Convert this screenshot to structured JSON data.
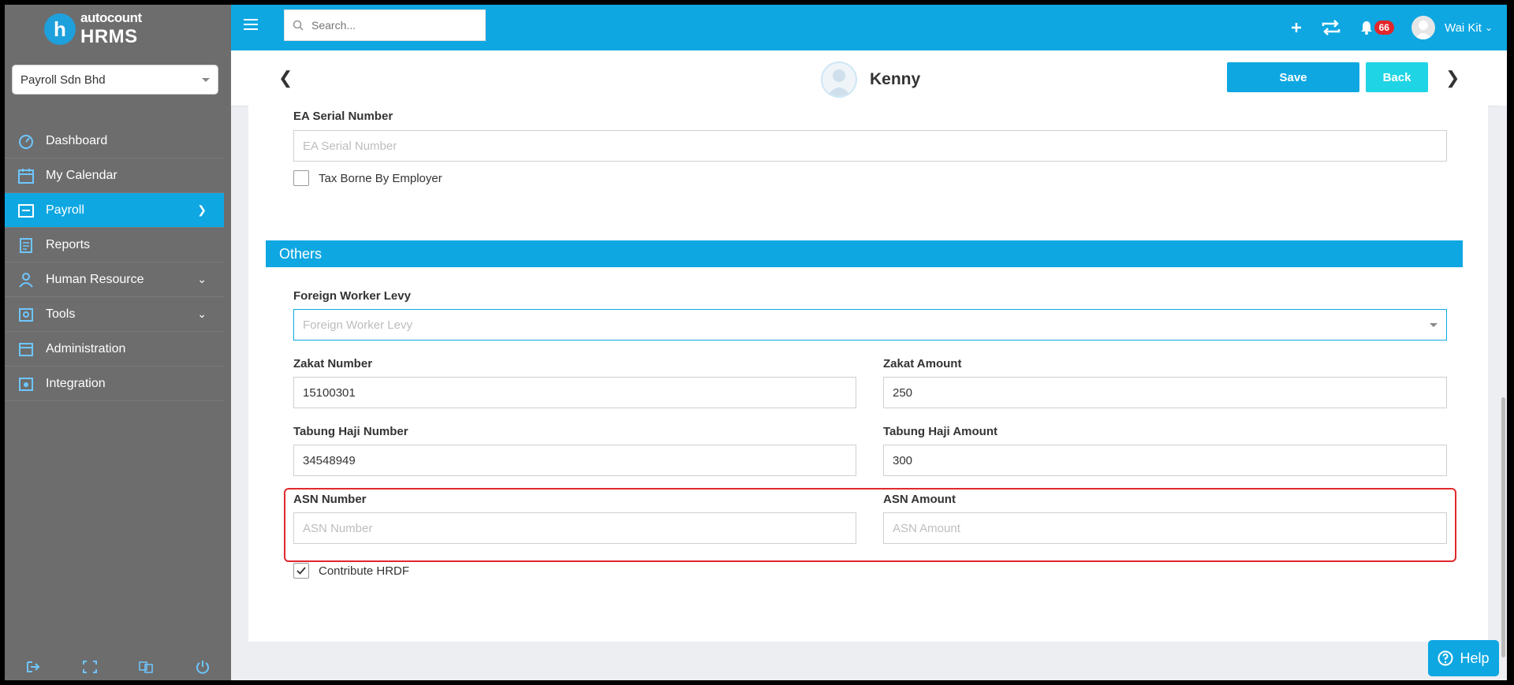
{
  "brand": {
    "mark": "h",
    "line1": "autocount",
    "line2": "HRMS"
  },
  "company_selector": {
    "value": "Payroll Sdn Bhd"
  },
  "sidebar": {
    "items": [
      {
        "label": "Dashboard",
        "icon": "dashboard-icon"
      },
      {
        "label": "My Calendar",
        "icon": "calendar-icon"
      },
      {
        "label": "Payroll",
        "icon": "payroll-icon",
        "active": true
      },
      {
        "label": "Reports",
        "icon": "reports-icon"
      },
      {
        "label": "Human Resource",
        "icon": "human-resource-icon"
      },
      {
        "label": "Tools",
        "icon": "tools-icon"
      },
      {
        "label": "Administration",
        "icon": "administration-icon"
      },
      {
        "label": "Integration",
        "icon": "integration-icon"
      }
    ]
  },
  "topbar": {
    "search_placeholder": "Search...",
    "notification_count": "66",
    "user_name": "Wai Kit"
  },
  "header": {
    "employee_name": "Kenny",
    "save_label": "Save",
    "back_label": "Back"
  },
  "form": {
    "ea_serial": {
      "label": "EA Serial Number",
      "placeholder": "EA Serial Number",
      "value": ""
    },
    "tax_borne": {
      "label": "Tax Borne By Employer",
      "checked": false
    },
    "section_others": "Others",
    "foreign_levy": {
      "label": "Foreign Worker Levy",
      "placeholder": "Foreign Worker Levy"
    },
    "zakat_number": {
      "label": "Zakat Number",
      "value": "15100301"
    },
    "zakat_amount": {
      "label": "Zakat Amount",
      "value": "250"
    },
    "tabung_number": {
      "label": "Tabung Haji Number",
      "value": "34548949"
    },
    "tabung_amount": {
      "label": "Tabung Haji Amount",
      "value": "300"
    },
    "asn_number": {
      "label": "ASN Number",
      "placeholder": "ASN Number"
    },
    "asn_amount": {
      "label": "ASN Amount",
      "placeholder": "ASN Amount"
    },
    "hrdf": {
      "label": "Contribute HRDF",
      "checked": true
    }
  },
  "help_label": "Help",
  "colors": {
    "accent": "#0ea7e2",
    "sidebar": "#6d6d6d",
    "highlight": "#e0282d",
    "back_button": "#1fd4e4",
    "badge": "#e3262b"
  }
}
